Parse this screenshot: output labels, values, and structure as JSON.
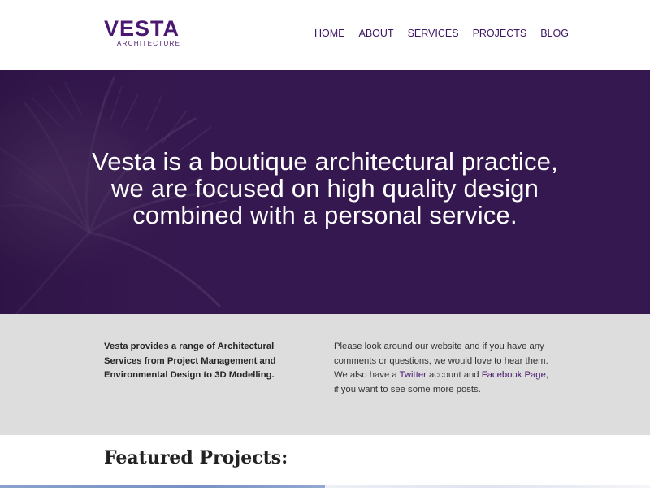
{
  "header": {
    "logo_word": "VESTA",
    "logo_sub": "ARCHITECTURE",
    "nav": [
      "HOME",
      "ABOUT",
      "SERVICES",
      "PROJECTS",
      "BLOG"
    ]
  },
  "hero": {
    "line1": "Vesta is a boutique architectural practice,",
    "line2": "we are focused on high quality design",
    "line3": "combined with a personal service."
  },
  "intro": {
    "left_text": "Vesta provides a range of Architectural Services from Project Management and Environmental Design to 3D Modelling.",
    "right_part1": "Please look around our website and if you have any comments or questions, we would love to hear them. We also have a ",
    "twitter_link": "Twitter",
    "right_part2": " account and ",
    "facebook_link": "Facebook Page",
    "right_part3": ", if you want to see some more posts."
  },
  "featured": {
    "title": "Featured Projects:"
  },
  "colors": {
    "brand_purple": "#4a1871",
    "hero_bg": "#35184f",
    "intro_bg": "#dddddd"
  }
}
